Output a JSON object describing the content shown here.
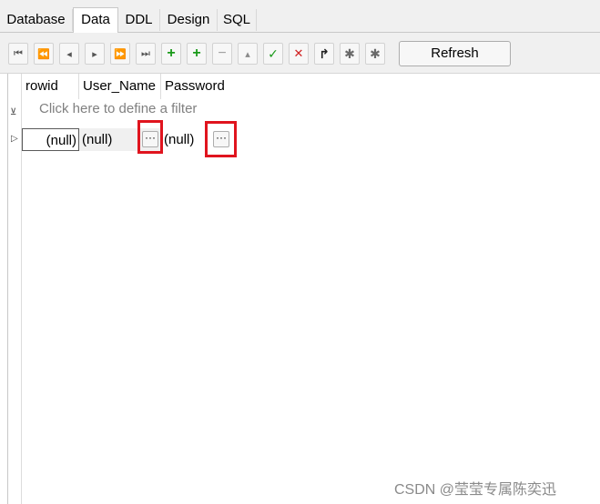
{
  "tabs": [
    {
      "label": "Database"
    },
    {
      "label": "Data",
      "active": true
    },
    {
      "label": "DDL"
    },
    {
      "label": "Design"
    },
    {
      "label": "SQL"
    }
  ],
  "toolbar": {
    "buttons": [
      {
        "name": "first-record",
        "glyph": "⏮"
      },
      {
        "name": "prior-page",
        "glyph": "⏪"
      },
      {
        "name": "prior-record",
        "glyph": "◂"
      },
      {
        "name": "next-record",
        "glyph": "▸"
      },
      {
        "name": "next-page",
        "glyph": "⏩"
      },
      {
        "name": "last-record",
        "glyph": "⏭"
      },
      {
        "name": "insert-record",
        "glyph": "+"
      },
      {
        "name": "append-record",
        "glyph": "+"
      },
      {
        "name": "delete-record",
        "glyph": "−"
      },
      {
        "name": "edit-record",
        "glyph": "▴"
      },
      {
        "name": "post-edit",
        "glyph": "✓"
      },
      {
        "name": "cancel-edit",
        "glyph": "✕"
      },
      {
        "name": "refresh-data",
        "glyph": "↱"
      },
      {
        "name": "set-null",
        "glyph": "✱"
      },
      {
        "name": "set-default",
        "glyph": "✱"
      }
    ],
    "refresh_label": "Refresh"
  },
  "grid": {
    "columns": [
      "rowid",
      "User_Name",
      "Password"
    ],
    "filter_placeholder": "Click here to define a filter",
    "rows": [
      {
        "rowid": "(null)",
        "user_name": "(null)",
        "password": "(null)"
      }
    ],
    "ellipsis_label": "···"
  },
  "watermark": "CSDN @莹莹专属陈奕迅"
}
